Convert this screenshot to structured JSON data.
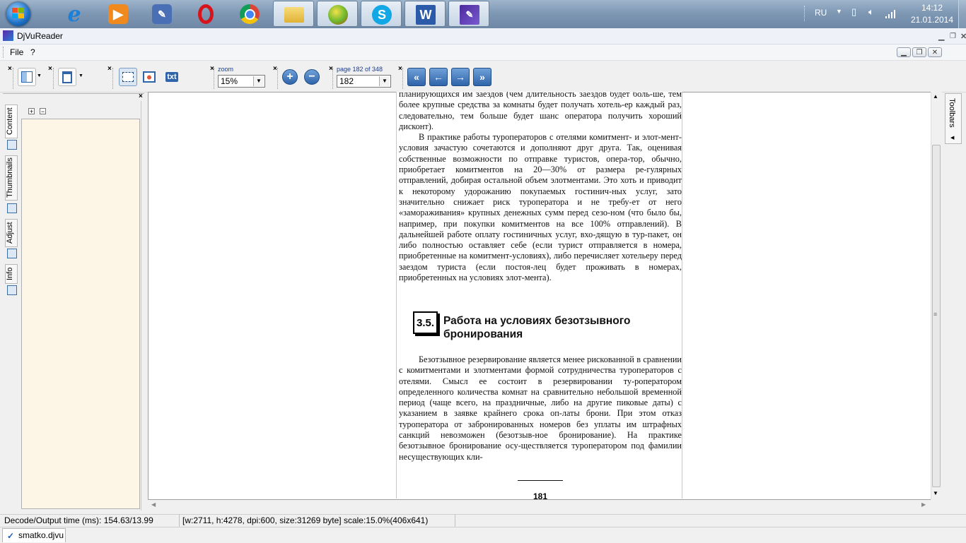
{
  "taskbar": {
    "apps": [
      {
        "name": "Internet Explorer",
        "icon": "ie-icon",
        "color": "#1e7fd6"
      },
      {
        "name": "Media Player",
        "icon": "media-player-icon",
        "color": "#f08a1e"
      },
      {
        "name": "Tools",
        "icon": "tools-icon",
        "color": "#4b6fb5"
      },
      {
        "name": "Opera",
        "icon": "opera-icon",
        "color": "#d7141a"
      },
      {
        "name": "Chrome",
        "icon": "chrome-icon",
        "color": "#3aa757"
      },
      {
        "name": "Explorer",
        "icon": "folder-icon",
        "color": "#e8c34a"
      },
      {
        "name": "Green App",
        "icon": "green-app-icon",
        "color": "#6bb82d"
      },
      {
        "name": "Skype",
        "icon": "skype-icon",
        "color": "#11a8e5"
      },
      {
        "name": "Word",
        "icon": "word-icon",
        "color": "#2b5aa8"
      },
      {
        "name": "DjVuReader",
        "icon": "djvu-icon",
        "color": "#4a2a9c"
      }
    ],
    "tray": {
      "language": "RU",
      "time": "14:12",
      "date": "21.01.2014"
    }
  },
  "window": {
    "title": "DjVuReader"
  },
  "menu": {
    "file": "File",
    "help": "?"
  },
  "toolbar": {
    "zoom_label": "zoom",
    "zoom_value": "15%",
    "page_label": "page 182 of 348",
    "page_value": "182",
    "txt_button": "txt"
  },
  "sidebar": {
    "tabs": [
      "Content",
      "Thumbnails",
      "Adjust",
      "Info"
    ],
    "active_tab": "Content",
    "expand_all": "+",
    "collapse_all": "−"
  },
  "right_panel": {
    "toolbars_label": "Toolbars"
  },
  "page": {
    "para1": "планирующихся им заездов (чем длительность заездов будет боль-ше, тем более крупные средства за комнаты будет получать хотель-ер каждый раз, следовательно, тем больше будет шанс оператора получить хороший дисконт).",
    "para2": "В практике работы туроператоров с отелями комитмент- и элот-мент-условия зачастую сочетаются и дополняют друг друга. Так, оценивая собственные возможности по отправке туристов, опера-тор, обычно, приобретает комитментов на 20—30% от размера ре-гулярных отправлений, добирая остальной объем элотментами. Это хоть и приводит к некоторому удорожанию покупаемых гостинич-ных услуг, зато значительно снижает риск туроператора и не требу-ет от него «замораживания» крупных денежных сумм перед сезо-ном (что было бы, например, при покупки комитментов на все 100% отправлений). В дальнейшей работе оплату гостиничных услуг, вхо-дящую в тур-пакет, он либо полностью оставляет себе (если турист отправляется в номера, приобретенные на комитмент-условиях), либо перечисляет хотельеру перед заездом туриста (если постоя-лец будет проживать в номерах, приобретенных на условиях элот-мента).",
    "section_number": "3.5.",
    "section_title": "Работа на условиях безотзывного бронирования",
    "para3": "Безотзывное резервирование является менее рискованной в сравнении с комитментами и элотментами формой сотрудничества туроператоров с отелями. Смысл ее состоит в резервировании ту-роператором определенного количества комнат на сравнительно небольшой временной период (чаще всего, на праздничные, либо на другие пиковые даты) с указанием в заявке крайнего срока оп-латы брони. При этом отказ туроператора от забронированных номеров без уплаты им штрафных санкций невозможен (безотзыв-ное бронирование). На практике безотзывное бронирование осу-ществляется туроператором под фамилии несуществующих кли-",
    "page_number": "181"
  },
  "status": {
    "decode_time": "Decode/Output time (ms): 154.63/13.99",
    "doc_info": "[w:2711, h:4278, dpi:600, size:31269 byte] scale:15.0%(406x641)"
  },
  "document_tab": {
    "name": "smatko.djvu"
  },
  "colors": {
    "accent_blue": "#2f64aa",
    "sidebar_panel": "#fdf5e6",
    "taskbar": "#7f98b4"
  }
}
